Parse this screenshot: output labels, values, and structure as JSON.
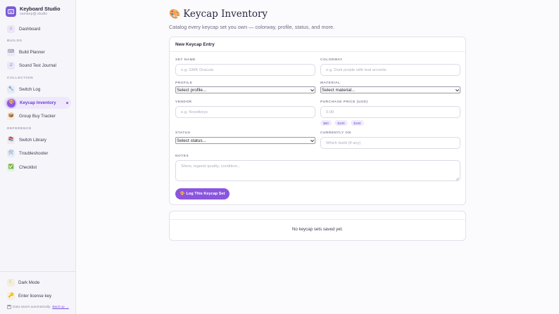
{
  "brand": {
    "name": "Keyboard Studio",
    "subtitle": "osmanp@.studio"
  },
  "sidebar": {
    "dashboard": {
      "label": "Dashboard"
    },
    "sections": {
      "builds": "BUILDS",
      "collection": "COLLECTION",
      "reference": "REFERENCE"
    },
    "builds": [
      {
        "label": "Build Planner",
        "icon": "keyboard-icon"
      },
      {
        "label": "Sound Test Journal",
        "icon": "music-note-icon"
      }
    ],
    "collection": [
      {
        "label": "Switch Log",
        "icon": "wrench-icon"
      },
      {
        "label": "Keycap Inventory",
        "icon": "palette-icon",
        "active": true
      },
      {
        "label": "Group Buy Tracker",
        "icon": "package-icon"
      }
    ],
    "reference": [
      {
        "label": "Switch Library",
        "icon": "books-icon"
      },
      {
        "label": "Troubleshooter",
        "icon": "tools-icon"
      },
      {
        "label": "Checklist",
        "icon": "checkmark-icon"
      }
    ],
    "bottom": {
      "dark_mode": "Dark Mode",
      "license": "Enter license key",
      "footer_text": "Data saves automatically.",
      "footer_link": "Back up →"
    }
  },
  "page": {
    "title": "Keycap Inventory",
    "title_icon": "🎨",
    "subtitle": "Catalog every keycap set you own — colorway, profile, status, and more."
  },
  "form": {
    "header": "New Keycap Entry",
    "set_name": {
      "label": "SET NAME",
      "placeholder": "e.g. GMK Dracula"
    },
    "colorway": {
      "label": "COLORWAY",
      "placeholder": "e.g. Dark purple with teal accents"
    },
    "profile": {
      "label": "PROFILE",
      "value": "Select profile..."
    },
    "material": {
      "label": "MATERIAL",
      "value": "Select material..."
    },
    "vendor": {
      "label": "VENDOR",
      "placeholder": "e.g. Novelkeys"
    },
    "price": {
      "label": "PURCHASE PRICE (USD)",
      "placeholder": "0.00",
      "chips": [
        "$60",
        "$100",
        "$160"
      ]
    },
    "status": {
      "label": "STATUS",
      "value": "Select status..."
    },
    "currently_on": {
      "label": "CURRENTLY ON",
      "placeholder": "Which build (if any)"
    },
    "notes": {
      "label": "NOTES",
      "placeholder": "Shine, legend quality, condition..."
    },
    "submit": {
      "label": "Log This Keycap Set",
      "icon": "🎨"
    }
  },
  "list": {
    "empty_text": "No keycap sets saved yet."
  },
  "colors": {
    "accent": "#8b55df",
    "accent_light": "#efe8fd",
    "sidebar_bg": "#f6f5f9"
  }
}
